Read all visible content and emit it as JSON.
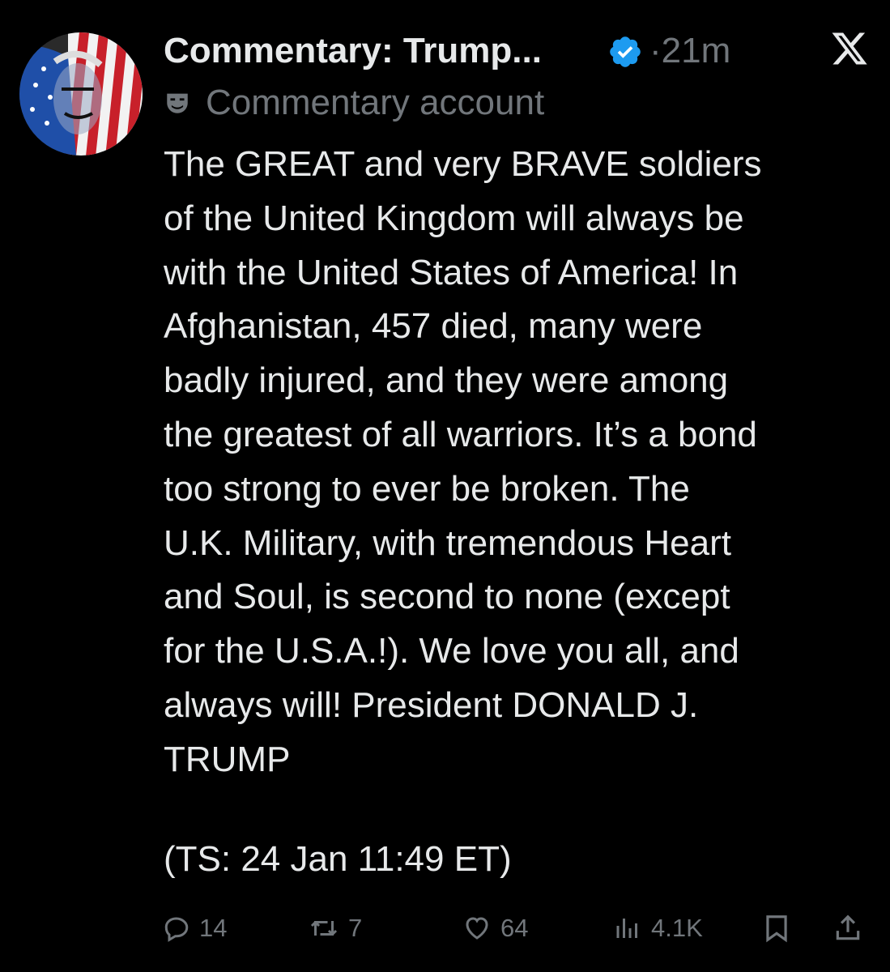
{
  "tweet": {
    "author_name": "Commentary: Trump...",
    "separator": "·",
    "time_ago": "21m",
    "account_label": "Commentary account",
    "text": "The GREAT and very BRAVE soldiers\nof the United Kingdom will always be\nwith the United States of America! In\nAfghanistan, 457 died, many were\nbadly injured, and they were among\nthe greatest of all warriors. It’s a bond\ntoo strong to ever be broken. The\nU.K. Military, with tremendous Heart\nand Soul, is second to none (except\nfor the U.S.A.!). We love you all, and\nalways will! President DONALD J.\nTRUMP",
    "timestamp_note": "(TS: 24 Jan 11:49 ET)"
  },
  "actions": {
    "replies": "14",
    "reposts": "7",
    "likes": "64",
    "views": "4.1K"
  },
  "icons": {
    "verified": "verified-badge-icon",
    "platform": "x-logo-icon",
    "label": "theater-mask-icon",
    "reply": "reply-icon",
    "repost": "repost-icon",
    "like": "heart-icon",
    "views": "views-icon",
    "bookmark": "bookmark-icon",
    "share": "share-icon"
  },
  "colors": {
    "background": "#000000",
    "text": "#e7e9ea",
    "muted": "#71767b",
    "verified": "#1d9bf0"
  }
}
